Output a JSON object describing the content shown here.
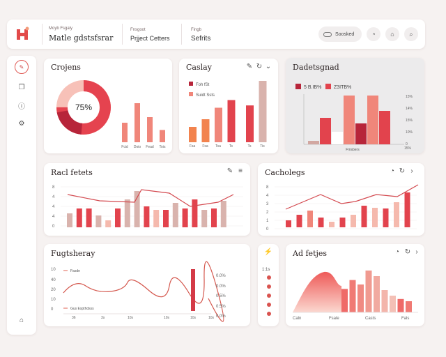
{
  "header": {
    "brand_small": "Moyb Fsgaly",
    "brand": "Matle gdstsfsrar",
    "crumb_small": "Fnsgoot",
    "crumb": "Prjject Cetters",
    "section_small": "Fingb",
    "section": "Sefrits",
    "search_label": "Soosked"
  },
  "cards": {
    "c1": "Crojens",
    "c2": "Caslay",
    "c3": "Dadetsgnad",
    "c4": "Racl fetets",
    "c5": "Cacholegs",
    "c6": "Fugtsheray",
    "c7": "Ad fetjes"
  },
  "accent": "#e0454f",
  "colors": {
    "dark": "#b7253a",
    "red": "#e2434d",
    "salmon": "#f0867a",
    "pale": "#f5b9ad",
    "tan": "#d9b3ad",
    "orange": "#f2834e"
  },
  "chart_data": [
    {
      "type": "pie",
      "title": "Crojens",
      "values": [
        75,
        25
      ],
      "center_label": "75%"
    },
    {
      "type": "bar",
      "title": "Crojens",
      "categories": [
        "Fcid",
        "Doio",
        "Fead",
        "Tois"
      ],
      "values": [
        35,
        70,
        45,
        22
      ]
    },
    {
      "type": "bar",
      "title": "Caslay",
      "legend": [
        "Foh fSt",
        "Suidt Ssts"
      ],
      "categories": [
        "Fia",
        "Fsa",
        "Ts",
        "Ts"
      ],
      "values": [
        20,
        30,
        45,
        55,
        48,
        80
      ],
      "xlabels": [
        "Fsa",
        "Fsa",
        "Tsa",
        "Ts",
        "Ts",
        "Tis"
      ]
    },
    {
      "type": "bar",
      "title": "Dadetsgnad",
      "legend": [
        "5 B.IB%",
        "Z3ITB%"
      ],
      "values": [
        5,
        38,
        18,
        70,
        30,
        70,
        48
      ],
      "yticks": [
        "15%",
        "14%",
        "15%",
        "10%",
        "0"
      ],
      "xlabel": "Fmsbers"
    },
    {
      "type": "bar",
      "title": "Racl fetets",
      "yticks": [
        "8",
        "4",
        "4",
        "4",
        "0"
      ],
      "values": [
        20,
        27,
        27,
        17,
        10,
        27,
        40,
        52,
        30,
        25,
        25,
        35,
        27,
        40,
        25,
        27,
        38
      ]
    },
    {
      "type": "bar",
      "title": "Cacholegs",
      "yticks": [
        "8",
        "4",
        "3",
        "2",
        "1",
        "0"
      ],
      "values": [
        10,
        18,
        24,
        14,
        8,
        14,
        18,
        31,
        28,
        27,
        36,
        50
      ],
      "xticks": [
        "Fa",
        "Fa",
        "Ba",
        "Da",
        "1a"
      ]
    },
    {
      "type": "line",
      "title": "Fugtsheray",
      "legend": [
        "Fasde",
        "Gus Espthdsss"
      ],
      "yticks": [
        "10",
        "40",
        "20",
        "10",
        "0"
      ],
      "xticks": [
        "36",
        "3s",
        "10s",
        "10s",
        "10s",
        "10s"
      ],
      "right_labels": [
        "0.0%",
        "0.0%",
        "0.5%",
        "0.5%",
        "0.0%"
      ]
    },
    {
      "type": "area",
      "title": "Ad fetjes",
      "values": [
        12,
        30,
        45,
        60,
        65,
        55,
        42,
        58,
        50,
        75,
        65,
        40,
        30,
        24,
        20
      ],
      "xticks": [
        "Caln",
        "Fsale",
        "Casts",
        "Fals"
      ],
      "side_labels": [
        "1:1s"
      ]
    }
  ]
}
